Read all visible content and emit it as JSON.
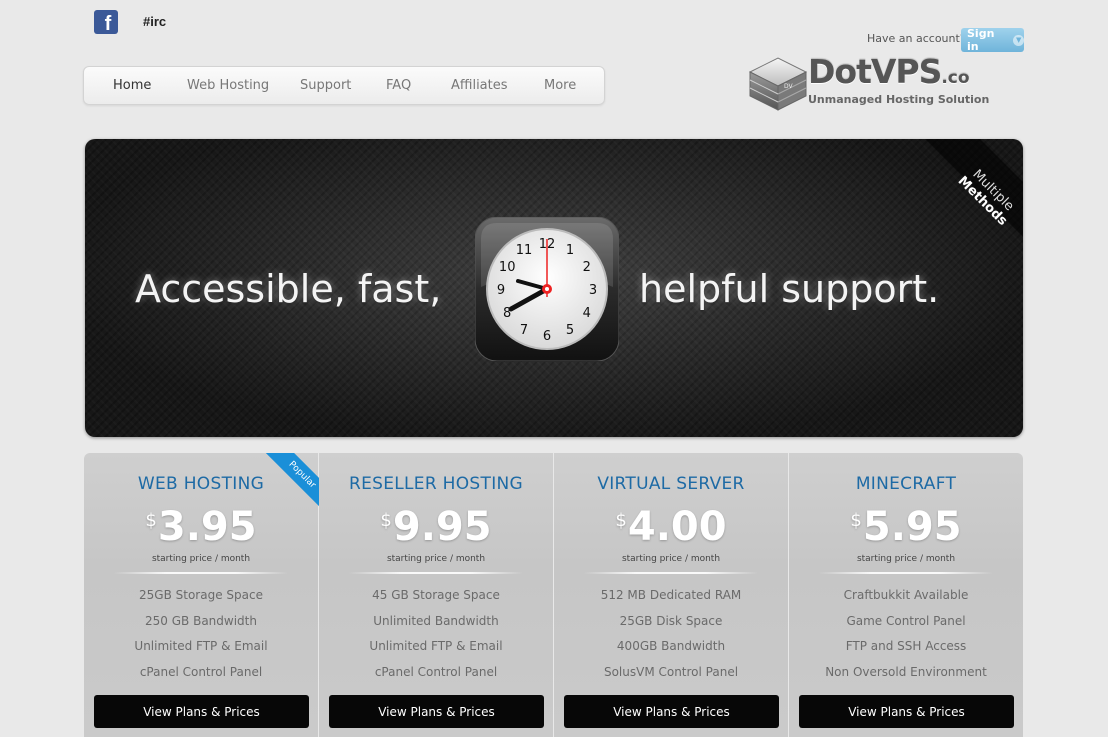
{
  "header": {
    "facebook_icon": "facebook-icon",
    "channel_link": "#irc",
    "account_prompt": "Have an account?",
    "signin_label": "Sign in"
  },
  "nav": {
    "items": [
      "Home",
      "Web Hosting",
      "Support",
      "FAQ",
      "Affiliates",
      "More"
    ],
    "active": "Home"
  },
  "logo": {
    "name": "DotVPS",
    "suffix": ".co",
    "tagline": "Unmanaged Hosting Solution",
    "server_label": "DV"
  },
  "banner": {
    "text_left": "Accessible, fast,",
    "text_right": "helpful support.",
    "ribbon_line1": "Multiple",
    "ribbon_line2": "Methods",
    "clock_numbers": [
      "12",
      "1",
      "2",
      "3",
      "4",
      "5",
      "6",
      "7",
      "8",
      "9",
      "10",
      "11"
    ]
  },
  "plans": [
    {
      "title": "WEB HOSTING",
      "currency": "$",
      "price": "3.95",
      "price_note": "starting price / month",
      "badge": "Popular",
      "features": [
        "25GB Storage Space",
        "250 GB Bandwidth",
        "Unlimited FTP & Email",
        "cPanel Control Panel"
      ],
      "button": "View Plans & Prices"
    },
    {
      "title": "RESELLER HOSTING",
      "currency": "$",
      "price": "9.95",
      "price_note": "starting price / month",
      "features": [
        "45 GB Storage Space",
        "Unlimited Bandwidth",
        "Unlimited FTP & Email",
        "cPanel Control Panel"
      ],
      "button": "View Plans & Prices"
    },
    {
      "title": "VIRTUAL SERVER",
      "currency": "$",
      "price": "4.00",
      "price_note": "starting price / month",
      "features": [
        "512 MB Dedicated RAM",
        "25GB Disk Space",
        "400GB Bandwidth",
        "SolusVM Control Panel"
      ],
      "button": "View Plans & Prices"
    },
    {
      "title": "MINECRAFT",
      "currency": "$",
      "price": "5.95",
      "price_note": "starting price / month",
      "features": [
        "Craftbukkit Available",
        "Game Control Panel",
        "FTP and SSH Access",
        "Non Oversold Environment"
      ],
      "button": "View Plans & Prices"
    }
  ],
  "colors": {
    "plan_title": "#1d6aa5",
    "signin_button": "#7bbde0",
    "popular_ribbon": "#1a8fd8",
    "button_bg": "#070707"
  }
}
